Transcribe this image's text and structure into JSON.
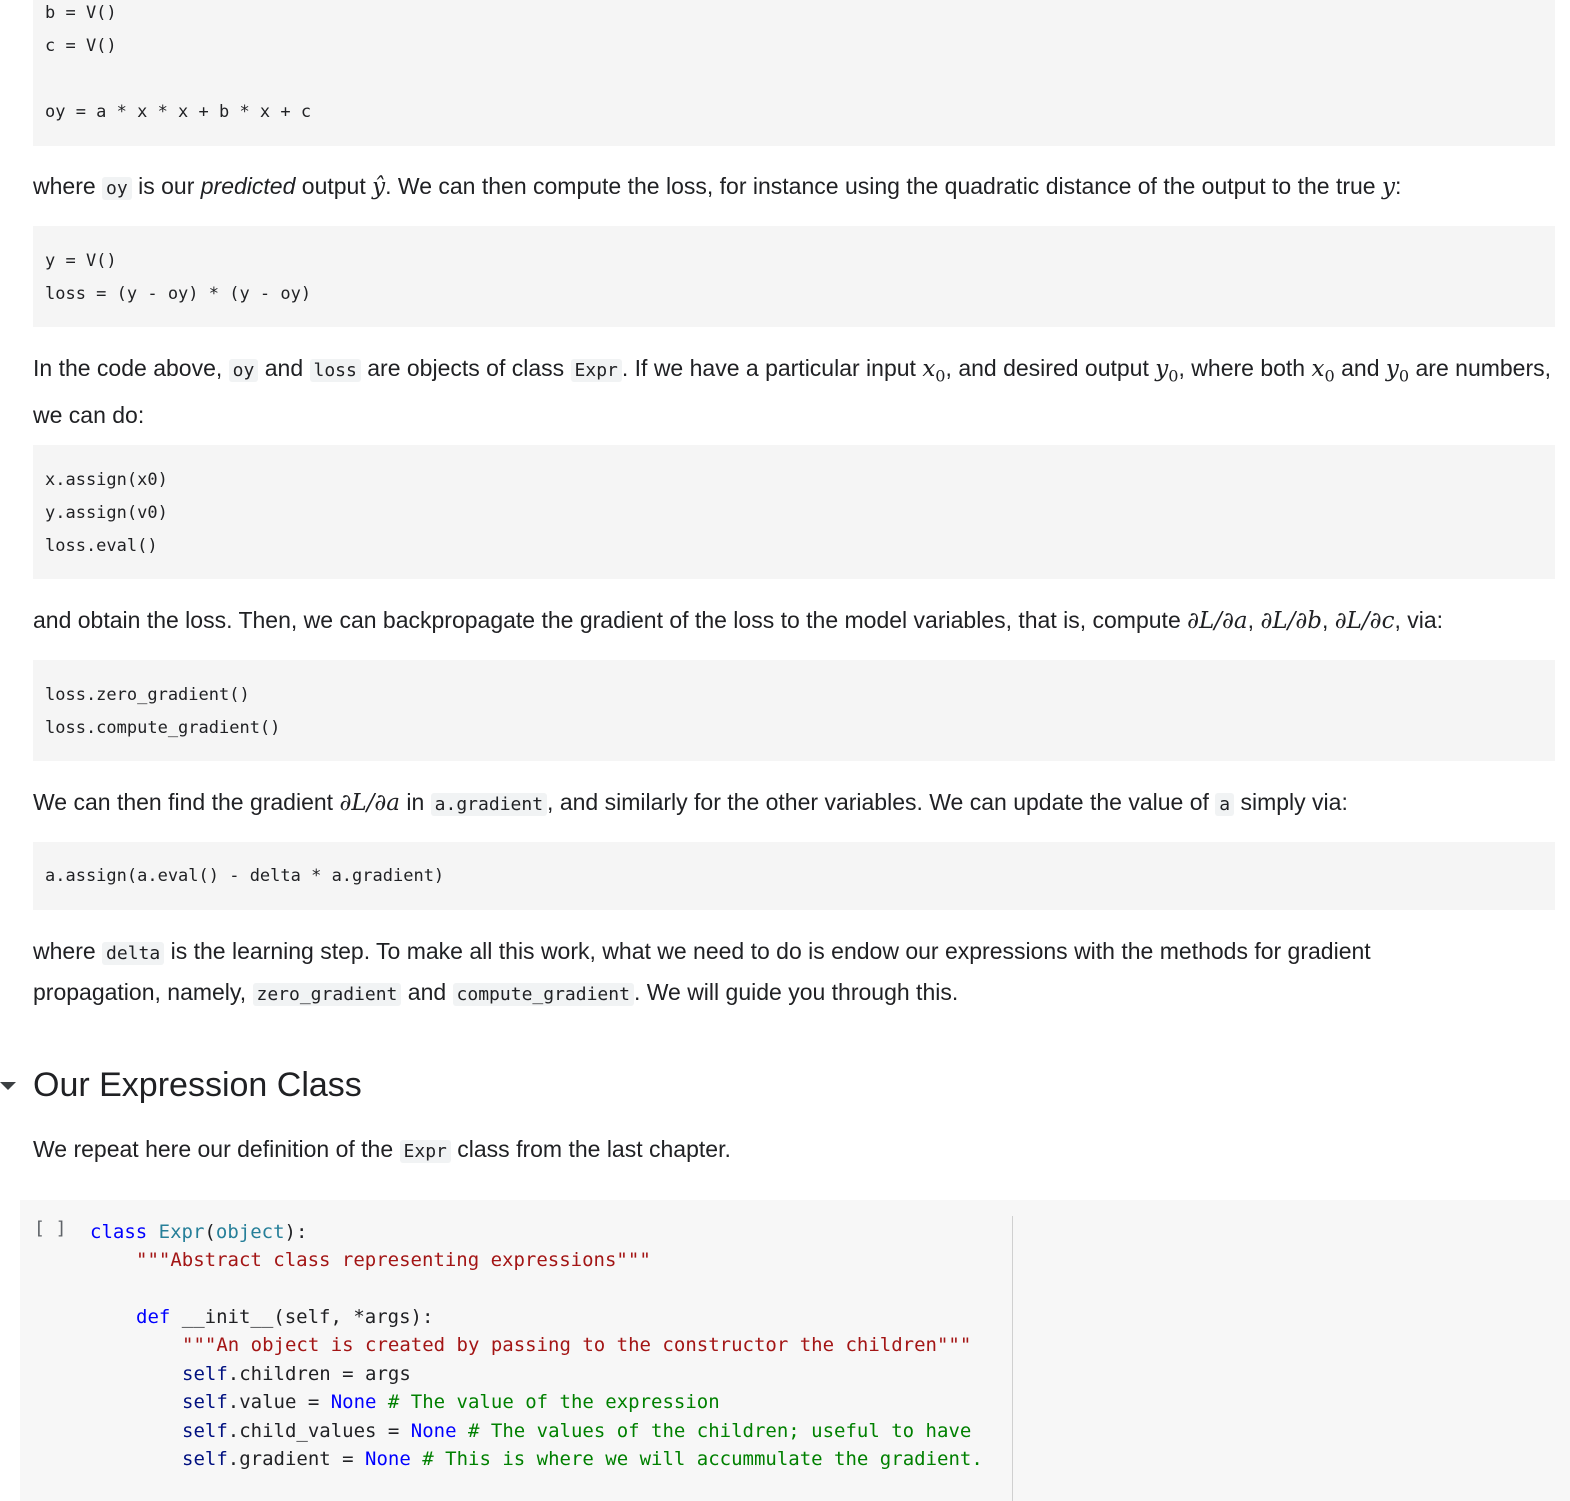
{
  "block1": {
    "lines": [
      "b = V()",
      "c = V()",
      "",
      "oy = a * x * x + b * x + c"
    ]
  },
  "para1": {
    "t1": "where ",
    "c1": "oy",
    "t2": " is our ",
    "em1": "predicted",
    "t3": " output ",
    "m1": "ŷ",
    "t4": ". We can then compute the loss, for instance using the quadratic distance of the output to the true ",
    "m2": "y",
    "t5": ":"
  },
  "block2": {
    "lines": [
      "y = V()",
      "loss = (y - oy) * (y - oy)"
    ]
  },
  "para2": {
    "t1": "In the code above, ",
    "c1": "oy",
    "t2": " and ",
    "c2": "loss",
    "t3": " are objects of class ",
    "c3": "Expr",
    "t4": ". If we have a particular input ",
    "m1": "x",
    "m1s": "0",
    "t5": ", and desired output ",
    "m2": "y",
    "m2s": "0",
    "t6": ", where both ",
    "m3": "x",
    "m3s": "0",
    "t7": " and ",
    "m4": "y",
    "m4s": "0",
    "t8": " are numbers, we can do:"
  },
  "block3": {
    "lines": [
      "x.assign(x0)",
      "y.assign(v0)",
      "loss.eval()"
    ]
  },
  "para3": {
    "t1": "and obtain the loss. Then, we can backpropagate the gradient of the loss to the model variables, that is, compute ",
    "m1": "∂L/∂a",
    "t2": ", ",
    "m2": "∂L/∂b",
    "t3": ", ",
    "m3": "∂L/∂c",
    "t4": ", via:"
  },
  "block4": {
    "lines": [
      "loss.zero_gradient()",
      "loss.compute_gradient()"
    ]
  },
  "para4": {
    "t1": "We can then find the gradient ",
    "m1": "∂L/∂a",
    "t2": " in ",
    "c1": "a.gradient",
    "t3": ", and similarly for the other variables. We can update the value of ",
    "c2": "a",
    "t4": " simply via:"
  },
  "block5": {
    "lines": [
      "a.assign(a.eval() - delta * a.gradient)"
    ]
  },
  "para5": {
    "t1": "where ",
    "c1": "delta",
    "t2": " is the learning step. To make all this work, what we need to do is endow our expressions with the methods for gradient propagation, namely, ",
    "c2": "zero_gradient",
    "t3": " and ",
    "c3": "compute_gradient",
    "t4": ". We will guide you through this."
  },
  "section": {
    "title": "Our Expression Class"
  },
  "para6": {
    "t1": "We repeat here our definition of the ",
    "c1": "Expr",
    "t2": " class from the last chapter."
  },
  "cell": {
    "run_label": "[ ]",
    "l1_kw": "class",
    "l1_name": "Expr",
    "l1_open": "(",
    "l1_base": "object",
    "l1_close": "):",
    "l2_str": "\"\"\"Abstract class representing expressions\"\"\"",
    "l4_kw": "def",
    "l4_rest": " __init__(self, *args):",
    "l5_str": "\"\"\"An object is created by passing to the constructor the children\"\"\"",
    "l6_self": "self",
    "l6_rest": ".children = args",
    "l7_self": "self",
    "l7_mid": ".value = ",
    "l7_none": "None",
    "l7_com": " # The value of the expression",
    "l8_self": "self",
    "l8_mid": ".child_values = ",
    "l8_none": "None",
    "l8_com": " # The values of the children; useful to have",
    "l9_self": "self",
    "l9_mid": ".gradient = ",
    "l9_none": "None",
    "l9_com": " # This is where we will accummulate the gradient."
  }
}
